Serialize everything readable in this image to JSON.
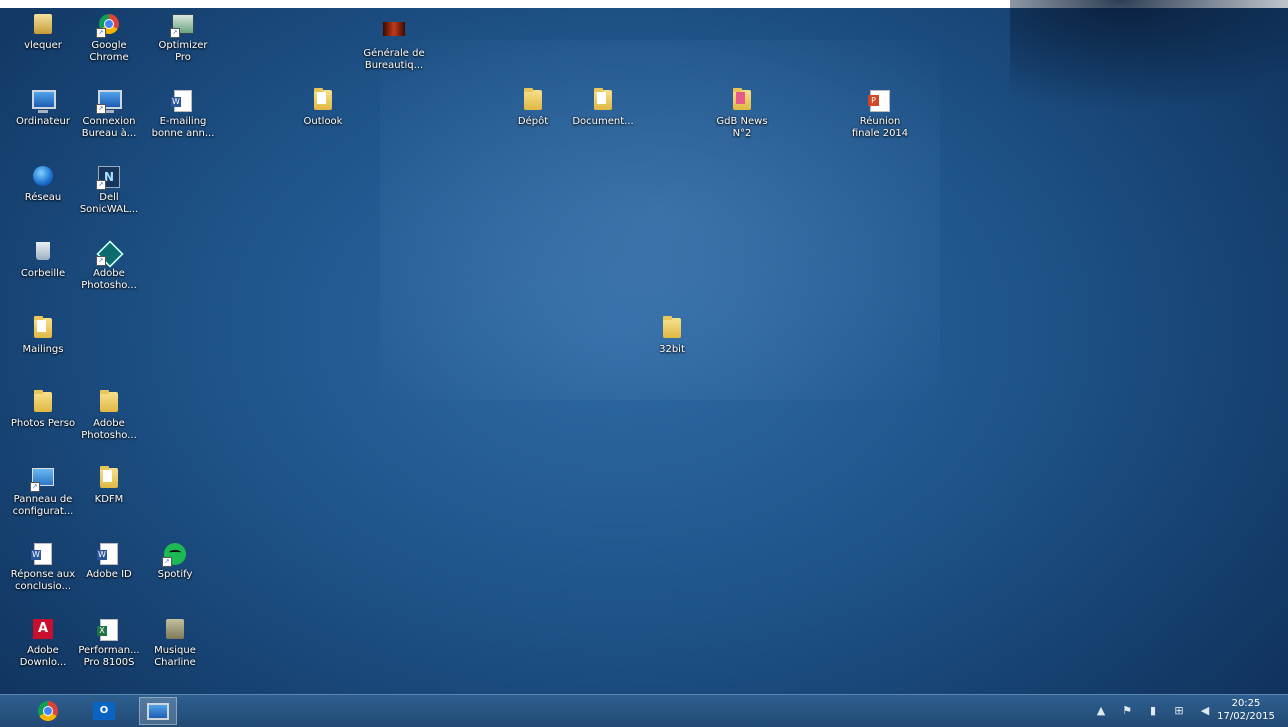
{
  "desktop": {
    "icons": {
      "vlequer": "vlequer",
      "chrome": "Google\nChrome",
      "optimizer": "Optimizer\nPro",
      "generale": "Générale de\nBureautiq...",
      "ordinateur": "Ordinateur",
      "connexion": "Connexion\nBureau à...",
      "emailing": "E-mailing\nbonne ann...",
      "outlook": "Outlook",
      "depot": "Dépôt",
      "document": "Document...",
      "gdb": "GdB News\nN°2",
      "reunion": "Réunion\nfinale 2014",
      "reseau": "Réseau",
      "dell": "Dell\nSonicWAL...",
      "corbeille": "Corbeille",
      "photoshop1": "Adobe\nPhotosho...",
      "mailings": "Mailings",
      "bit32": "32bit",
      "photos_perso": "Photos Perso",
      "photoshop2": "Adobe\nPhotosho...",
      "panneau": "Panneau de\nconfigurat...",
      "kdfm": "KDFM",
      "reponse": "Réponse aux\nconclusio...",
      "adobe_id": "Adobe ID",
      "spotify": "Spotify",
      "adobe_downlo": "Adobe\nDownlo...",
      "performan": "Performan...\nPro 8100S",
      "musique": "Musique\nCharline"
    }
  },
  "taskbar": {
    "pinned": [
      "chrome-icon",
      "outlook-icon",
      "remote-desktop-icon"
    ],
    "outlook_glyph": "O",
    "clock_time": "20:25",
    "clock_date": "17/02/2015"
  }
}
